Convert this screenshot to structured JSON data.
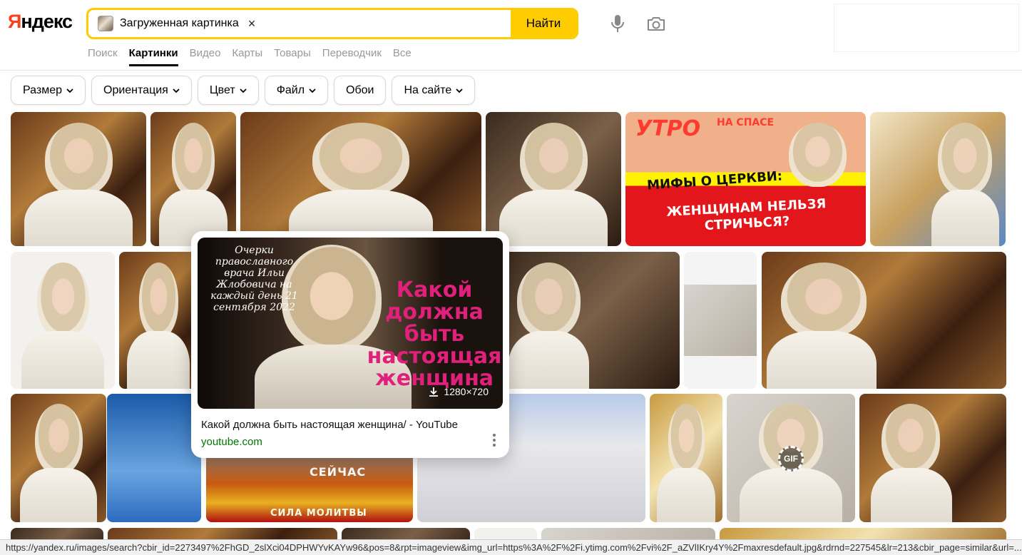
{
  "logo": {
    "y": "Я",
    "rest": "ндекс"
  },
  "search": {
    "chip_label": "Загруженная картинка",
    "chip_remove": "×",
    "button": "Найти"
  },
  "nav": {
    "items": [
      "Поиск",
      "Картинки",
      "Видео",
      "Карты",
      "Товары",
      "Переводчик",
      "Все"
    ],
    "active": "Картинки"
  },
  "filters": [
    {
      "label": "Размер",
      "dropdown": true
    },
    {
      "label": "Ориентация",
      "dropdown": true
    },
    {
      "label": "Цвет",
      "dropdown": true
    },
    {
      "label": "Файл",
      "dropdown": true
    },
    {
      "label": "Обои",
      "dropdown": false
    },
    {
      "label": "На сайте",
      "dropdown": true
    }
  ],
  "tiles_text": {
    "utro": "УТРО",
    "naspase": "НА СПАСЕ",
    "myths": "МИФЫ О ЦЕРКВИ:",
    "nelzya": "ЖЕНЩИНАМ НЕЛЬЗЯ СТРИЧЬСЯ?",
    "seichas": "СЕЙЧАС",
    "sila": "СИЛА МОЛИТВЫ",
    "gif": "GIF"
  },
  "popup": {
    "overlay_left": "Очерки православного врача Ильи Жлобовича на каждый день 21 сентября 2022",
    "overlay_right": "Какой должна быть настоящая женщина",
    "dimensions": "1280×720",
    "title": "Какой должна быть настоящая женщина/ - YouTube",
    "host": "youtube.com"
  },
  "status_url": "https://yandex.ru/images/search?cbir_id=2273497%2FhGD_2slXci04DPHWYvKAYw96&pos=8&rpt=imageview&img_url=https%3A%2F%2Fi.ytimg.com%2Fvi%2F_aZVlIKry4Y%2Fmaxresdefault.jpg&rdrnd=227545&lr=213&cbir_page=similar&url=...",
  "colors": {
    "brand_yellow": "#ffcc00",
    "logo_red": "#fc3f1d",
    "host_green": "#007700"
  }
}
